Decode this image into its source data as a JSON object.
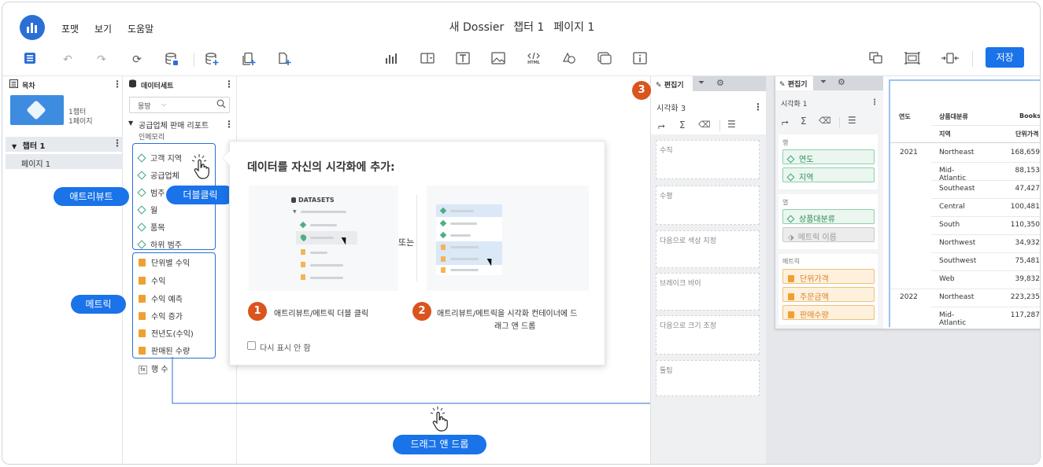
{
  "header": {
    "menu": [
      "포맷",
      "보기",
      "도움말"
    ],
    "doc_name": "새 Dossier",
    "chapter": "챕터 1",
    "page": "페이지 1"
  },
  "toolbar": {
    "save_label": "저장",
    "left_icons": [
      "toc-icon",
      "undo-icon",
      "redo-icon",
      "refresh-icon",
      "data-source-icon",
      "add-data-icon",
      "duplicate-icon",
      "new-page-icon"
    ],
    "center_icons": [
      "bar-chart-icon",
      "filter-icon",
      "text-icon",
      "image-icon",
      "html-icon",
      "shape-icon",
      "container-icon",
      "info-icon"
    ],
    "right_icons": [
      "panel-stack-icon",
      "information-window-icon",
      "fit-icon"
    ]
  },
  "toc": {
    "title": "목차",
    "thumb_info": [
      "1챕터",
      "1페이지"
    ],
    "chapter": "챕터 1",
    "page": "페이지 1"
  },
  "datasets": {
    "title": "데이터세트",
    "search_placeholder": "몽땅",
    "dataset_name": "공급업체 판매 리포트",
    "dataset_sub": "인메모리",
    "attributes": [
      "고객 지역",
      "공급업체",
      "범주",
      "월",
      "품목",
      "하위 범주"
    ],
    "metrics": [
      "단위별 수익",
      "수익",
      "수익 예측",
      "수익 증가",
      "전년도(수익)",
      "판매된 수량"
    ],
    "fx_item": "행 수"
  },
  "callouts": {
    "attribute": "애트리뷰트",
    "double_click": "더블클릭",
    "metric": "메트릭",
    "drag_drop": "드래그 앤 드롭"
  },
  "popup": {
    "title": "데이터를 자신의 시각화에 추가:",
    "mock_label": "DATASETS",
    "or": "또는",
    "step1_num": "1",
    "step1_text": "애트리뷰트/메트릭 더블 클릭",
    "step2_num": "2",
    "step2_line1": "애트리뷰트/메트릭을 시각화 컨테이너에 드",
    "step2_line2": "래그 앤 드롭",
    "checkbox_label": "다시 표시 안 함"
  },
  "editor_empty": {
    "badge": "3",
    "tab_label": "편집기",
    "viz_title": "시각화 3",
    "zones": [
      "수직",
      "수평",
      "다음으로 색상 지정",
      "브레이크 바이",
      "다음으로 크기 조정",
      "툴팁"
    ]
  },
  "editor_filled": {
    "tab_label": "편집기",
    "viz_title": "시각화 1",
    "rows_label": "행",
    "rows": [
      "연도",
      "지역"
    ],
    "columns_label": "열",
    "columns": [
      "상품대분류",
      "메트릭 이름"
    ],
    "metrics_label": "메트릭",
    "metrics": [
      "단위가격",
      "주문금액",
      "판매수량"
    ]
  },
  "grid": {
    "col_year": "연도",
    "col_category": "상품대분류",
    "col_books": "Books",
    "col_region": "지역",
    "col_unit_price": "단위가격",
    "rows": [
      {
        "year": "2021",
        "region": "Northeast",
        "value": "168,659"
      },
      {
        "year": "",
        "region": "Mid-Atlantic",
        "value": "88,153"
      },
      {
        "year": "",
        "region": "Southeast",
        "value": "47,427"
      },
      {
        "year": "",
        "region": "Central",
        "value": "100,481"
      },
      {
        "year": "",
        "region": "South",
        "value": "110,350"
      },
      {
        "year": "",
        "region": "Northwest",
        "value": "34,932"
      },
      {
        "year": "",
        "region": "Southwest",
        "value": "75,481"
      },
      {
        "year": "",
        "region": "Web",
        "value": "39,832"
      },
      {
        "year": "2022",
        "region": "Northeast",
        "value": "223,235"
      },
      {
        "year": "",
        "region": "Mid-Atlantic",
        "value": "117,287"
      }
    ]
  }
}
